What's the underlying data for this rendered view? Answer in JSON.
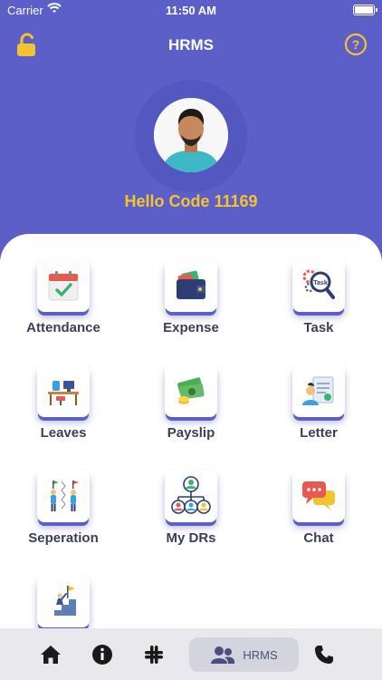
{
  "status_bar": {
    "carrier": "Carrier",
    "time": "11:50 AM"
  },
  "header": {
    "title": "HRMS",
    "left_icon": "unlock-icon",
    "right_icon": "help-icon",
    "icon_color": "#f4c430"
  },
  "profile": {
    "greeting": "Hello Code 11169"
  },
  "colors": {
    "primary": "#5b5fc7",
    "accent": "#f4c430",
    "label": "#3b3f56"
  },
  "menu": [
    {
      "id": "attendance",
      "label": "Attendance",
      "icon": "calendar-check-icon"
    },
    {
      "id": "expense",
      "label": "Expense",
      "icon": "wallet-icon"
    },
    {
      "id": "task",
      "label": "Task",
      "icon": "task-search-icon"
    },
    {
      "id": "leaves",
      "label": "Leaves",
      "icon": "office-desk-icon"
    },
    {
      "id": "payslip",
      "label": "Payslip",
      "icon": "money-icon"
    },
    {
      "id": "letter",
      "label": "Letter",
      "icon": "document-person-icon"
    },
    {
      "id": "seperation",
      "label": "Seperation",
      "icon": "separation-icon"
    },
    {
      "id": "my-drs",
      "label": "My DRs",
      "icon": "org-chart-icon"
    },
    {
      "id": "chat",
      "label": "Chat",
      "icon": "chat-bubbles-icon"
    },
    {
      "id": "goal",
      "label": "",
      "icon": "goal-flag-icon"
    }
  ],
  "bottom_nav": [
    {
      "id": "home",
      "icon": "home-icon"
    },
    {
      "id": "info",
      "icon": "info-icon"
    },
    {
      "id": "slack",
      "icon": "slack-icon"
    },
    {
      "id": "hrms",
      "icon": "users-icon",
      "label": "HRMS",
      "active": true
    },
    {
      "id": "phone",
      "icon": "phone-icon"
    }
  ]
}
